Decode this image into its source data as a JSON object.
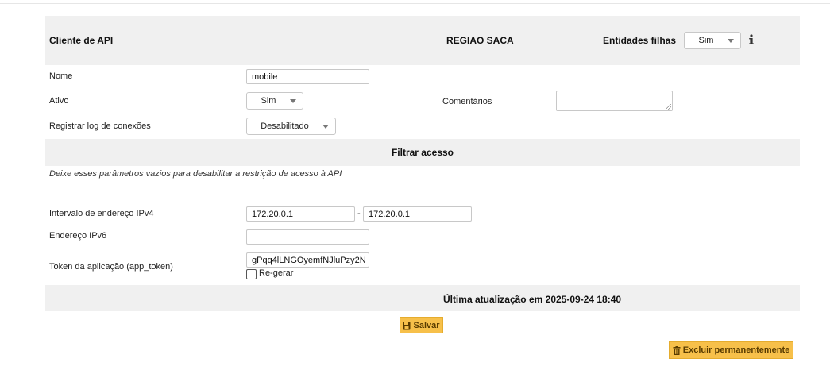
{
  "header": {
    "title": "Cliente de API",
    "region": "REGIAO SACA",
    "child_entities_label": "Entidades filhas",
    "child_entities_value": "Sim",
    "info_icon": "info-icon"
  },
  "form": {
    "name_label": "Nome",
    "name_value": "mobile",
    "active_label": "Ativo",
    "active_value": "Sim",
    "comments_label": "Comentários",
    "comments_value": "",
    "log_label": "Registrar log de conexões",
    "log_value": "Desabilitado"
  },
  "filter": {
    "title": "Filtrar acesso",
    "hint": "Deixe esses parâmetros vazios para desabilitar a restrição de acesso à API",
    "ipv4_label": "Intervalo de endereço IPv4",
    "ipv4_start": "172.20.0.1",
    "ipv4_sep": "-",
    "ipv4_end": "172.20.0.1",
    "ipv6_label": "Endereço IPv6",
    "ipv6_value": "",
    "token_label": "Token da aplicação (app_token)",
    "token_value": "gPqq4lLNGOyemfNJluPzy2N",
    "regen_label": "Re-gerar"
  },
  "footer": {
    "last_update": "Última atualização em 2025-09-24 18:40",
    "save_label": "Salvar",
    "delete_label": "Excluir permanentemente",
    "button_color": "#f7c04a"
  }
}
